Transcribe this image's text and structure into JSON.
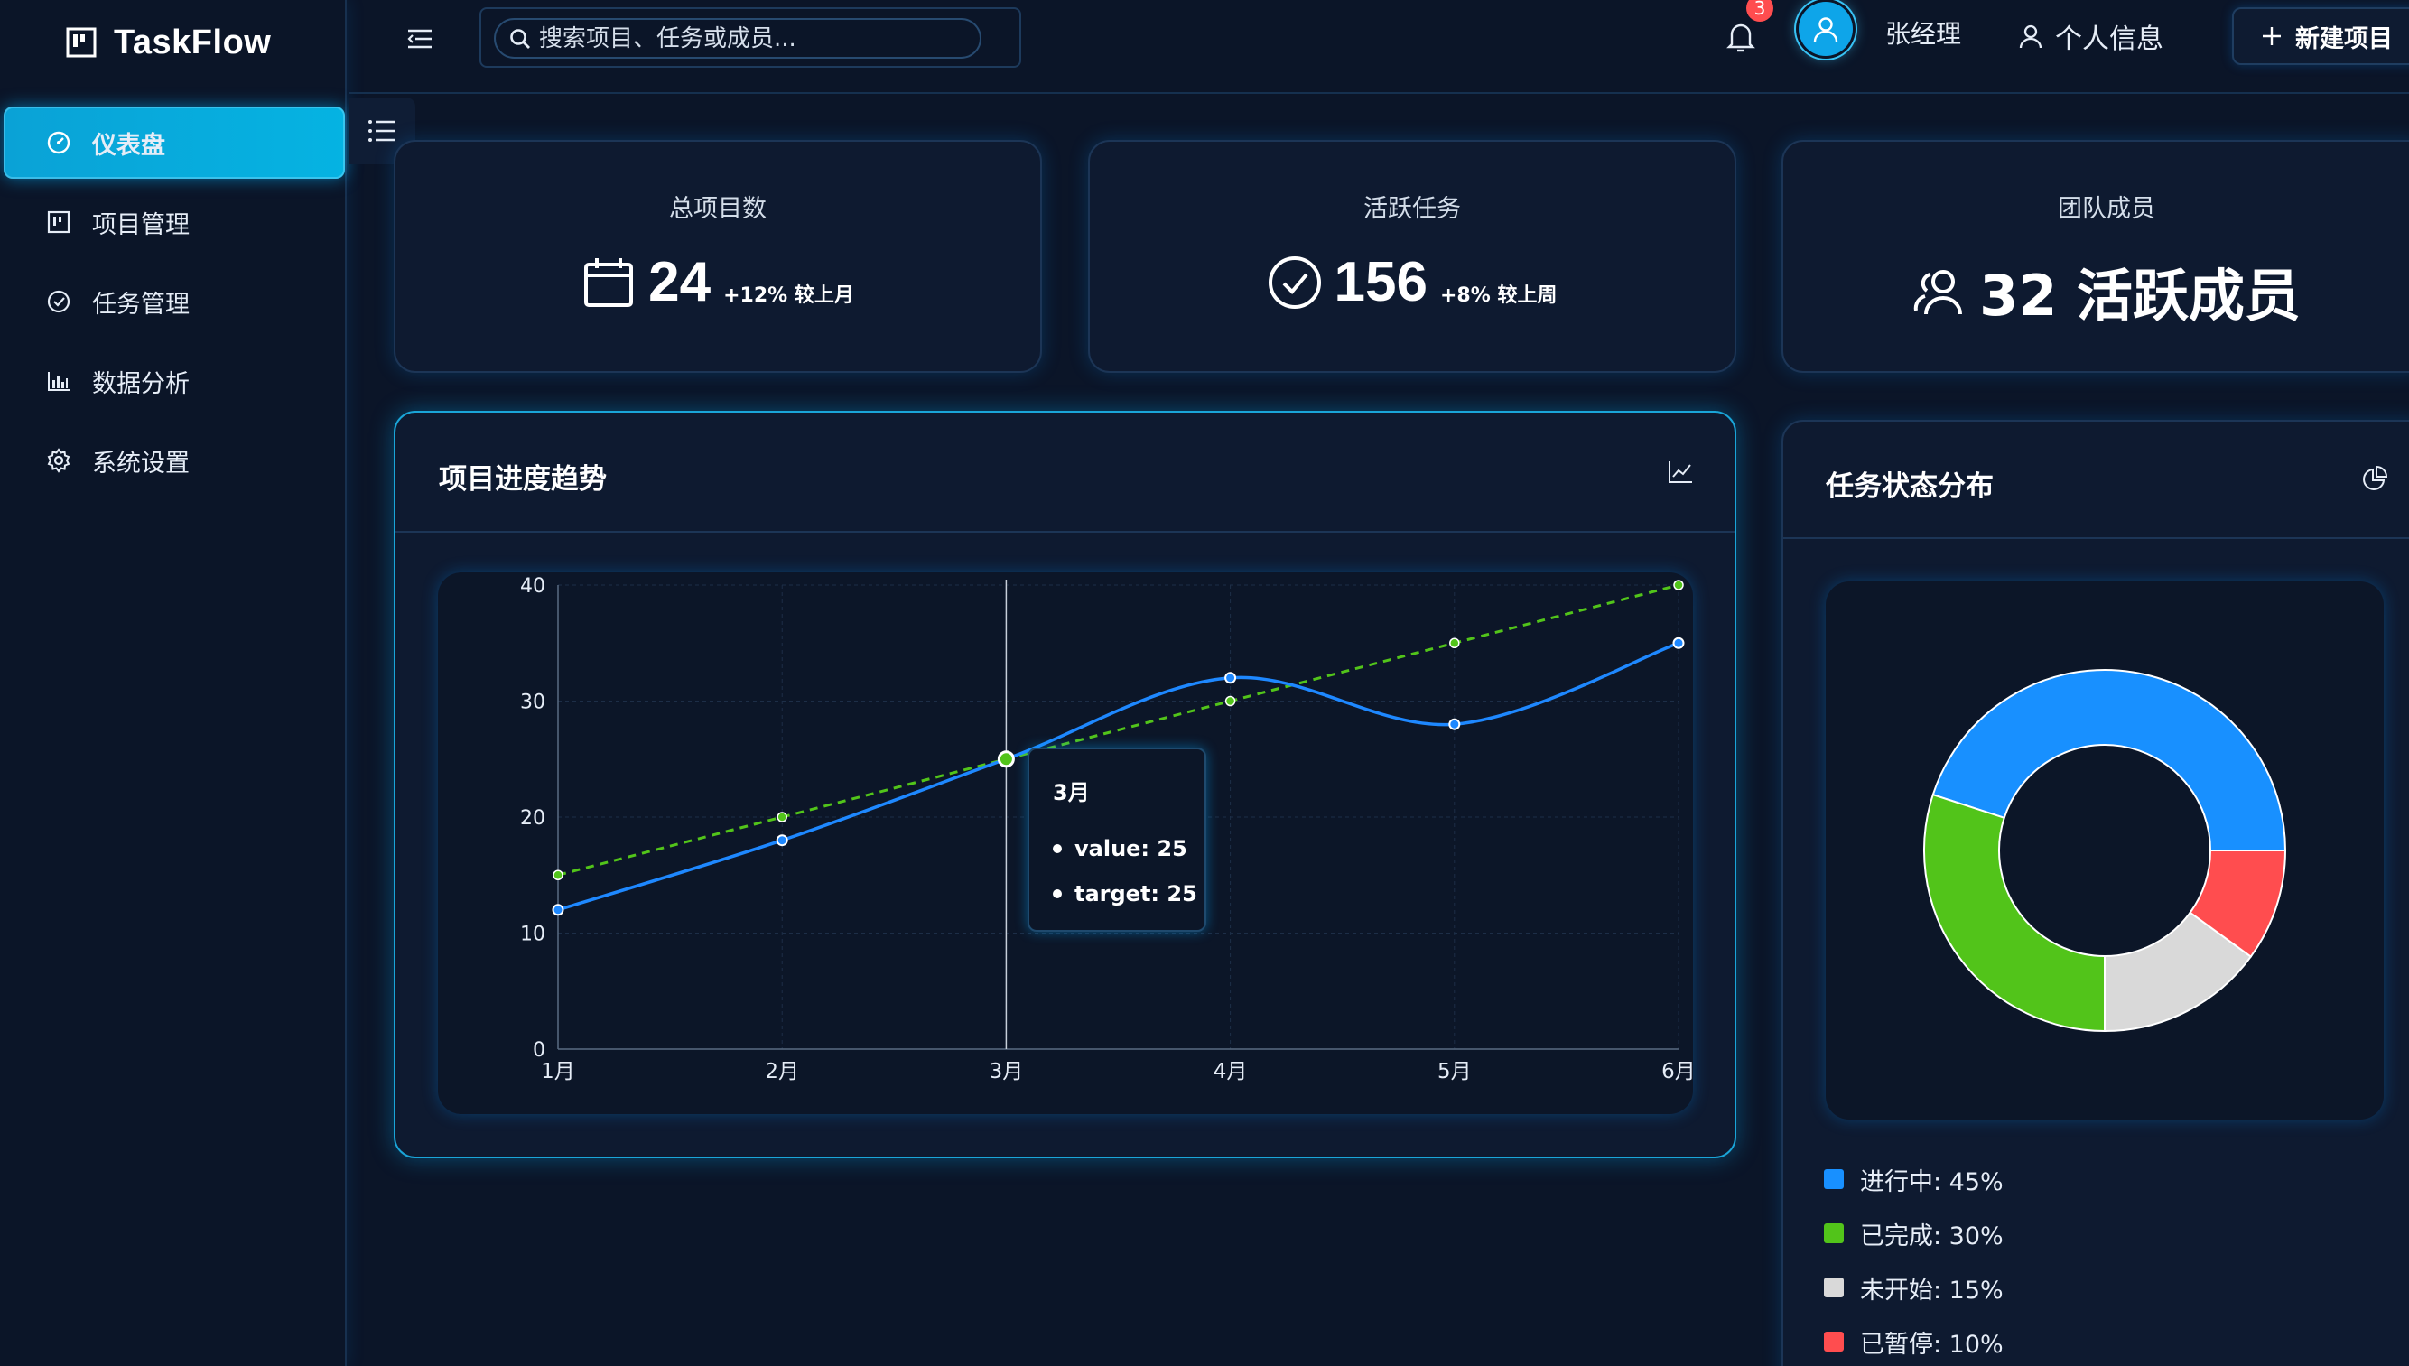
{
  "app": {
    "name": "TaskFlow"
  },
  "sidebar": {
    "items": [
      {
        "label": "仪表盘",
        "icon": "dashboard-icon",
        "active": true
      },
      {
        "label": "项目管理",
        "icon": "project-icon",
        "active": false
      },
      {
        "label": "任务管理",
        "icon": "task-check-icon",
        "active": false
      },
      {
        "label": "数据分析",
        "icon": "bar-chart-icon",
        "active": false
      },
      {
        "label": "系统设置",
        "icon": "gear-icon",
        "active": false
      }
    ]
  },
  "header": {
    "search_placeholder": "搜索项目、任务或成员...",
    "notification_count": "3",
    "user_name": "张经理",
    "profile_label": "个人信息",
    "new_project_label": "新建项目"
  },
  "stats": [
    {
      "title": "总项目数",
      "value": "24",
      "change": "+12% 较上月",
      "icon": "calendar-icon"
    },
    {
      "title": "活跃任务",
      "value": "156",
      "change": "+8% 较上周",
      "icon": "check-circle-icon"
    },
    {
      "title": "团队成员",
      "value": "32 活跃成员",
      "icon": "team-icon"
    }
  ],
  "progress_panel": {
    "title": "项目进度趋势",
    "tooltip": {
      "title": "3月",
      "rows": [
        "value: 25",
        "target: 25"
      ]
    }
  },
  "status_panel": {
    "title": "任务状态分布",
    "legend": [
      "进行中: 45%",
      "已完成: 30%",
      "未开始: 15%",
      "已暂停: 10%"
    ]
  },
  "colors": {
    "accent": "#05b3e2",
    "value_line": "#1e88ff",
    "target_line": "#52c41a",
    "in_progress": "#1890ff",
    "done": "#52c41a",
    "not_started": "#d9d9d9",
    "paused": "#ff4d4f"
  },
  "chart_data": [
    {
      "type": "line",
      "categories": [
        "1月",
        "2月",
        "3月",
        "4月",
        "5月",
        "6月"
      ],
      "series": [
        {
          "name": "value",
          "values": [
            12,
            18,
            25,
            32,
            28,
            35
          ]
        },
        {
          "name": "target",
          "values": [
            15,
            20,
            25,
            30,
            35,
            40
          ]
        }
      ],
      "y_ticks": [
        "0",
        "10",
        "20",
        "30",
        "40"
      ],
      "ylim": [
        0,
        40
      ],
      "grid": true,
      "highlighted_category": "3月"
    },
    {
      "type": "pie",
      "donut": true,
      "categories": [
        "进行中",
        "已完成",
        "未开始",
        "已暂停"
      ],
      "values": [
        45,
        30,
        15,
        10
      ]
    }
  ]
}
